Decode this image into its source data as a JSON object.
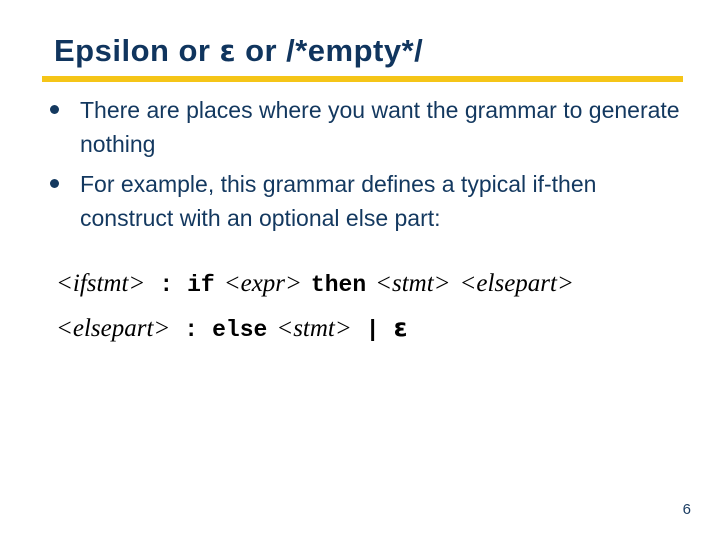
{
  "slide": {
    "background_color": "#ffffff",
    "accent_color": "#f5c518",
    "heading_color": "#10355e",
    "body_color": "#13385f",
    "title": {
      "word1": "Epsilon",
      "word2": "or",
      "epsilon_symbol": "ε",
      "word3": "or",
      "word4": "/*empty*/"
    },
    "bullets": [
      "There are places where you want the grammar to generate nothing",
      "For example, this grammar defines a typical if-then construct with an optional else part:"
    ],
    "grammar": {
      "lines": [
        {
          "tokens": [
            {
              "kind": "nonterminal",
              "text": "<ifstmt>"
            },
            {
              "kind": "punctuation",
              "text": ":"
            },
            {
              "kind": "terminal",
              "text": "if"
            },
            {
              "kind": "nonterminal",
              "text": "<expr>"
            },
            {
              "kind": "terminal",
              "text": "then"
            },
            {
              "kind": "nonterminal",
              "text": "<stmt>"
            },
            {
              "kind": "nonterminal",
              "text": "<elsepart>"
            }
          ]
        },
        {
          "tokens": [
            {
              "kind": "nonterminal",
              "text": "<elsepart>"
            },
            {
              "kind": "punctuation",
              "text": ":"
            },
            {
              "kind": "terminal",
              "text": "else"
            },
            {
              "kind": "nonterminal",
              "text": "<stmt>"
            },
            {
              "kind": "punctuation",
              "text": "|"
            },
            {
              "kind": "epsilon",
              "text": "ε"
            }
          ]
        }
      ]
    },
    "page_number": "6"
  }
}
